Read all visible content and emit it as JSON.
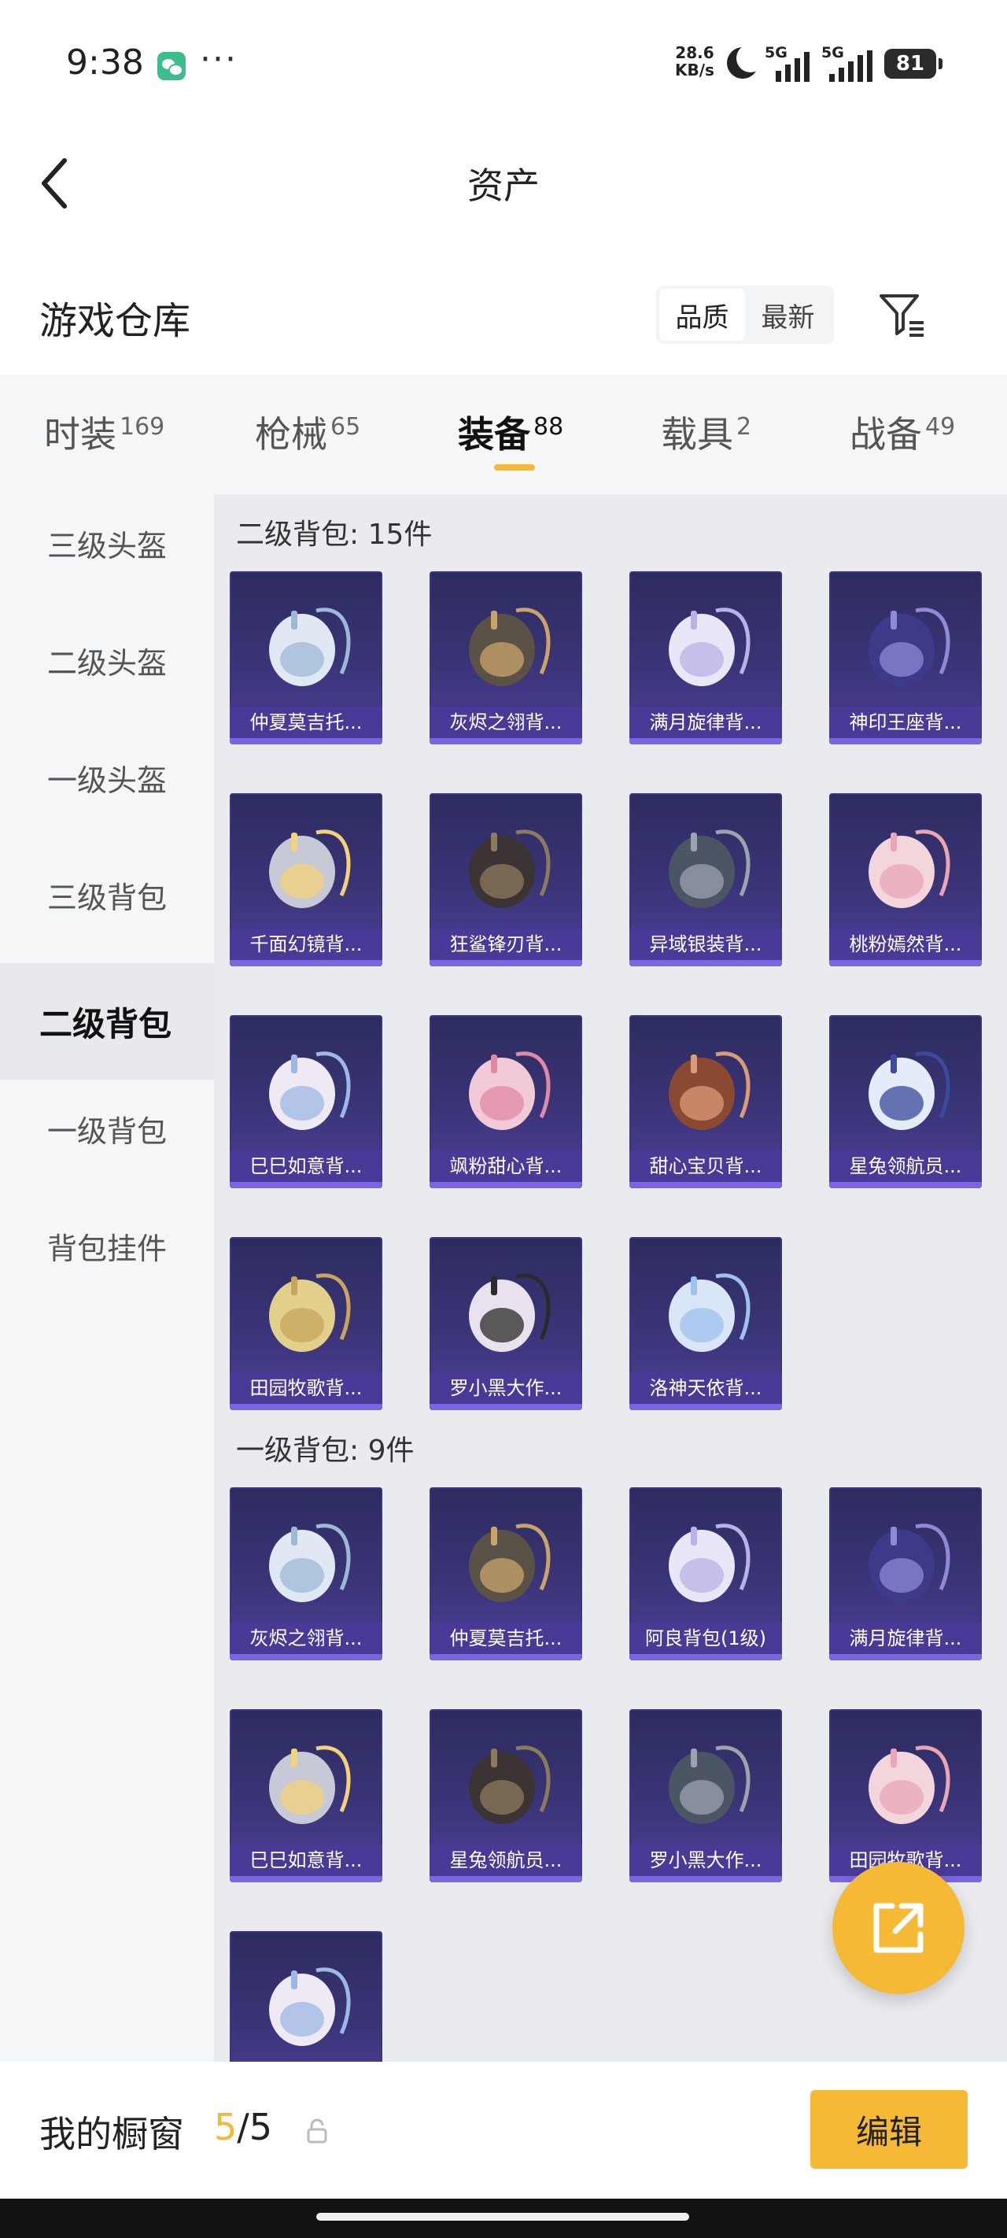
{
  "status": {
    "time": "9:38",
    "net_speed_value": "28.6",
    "net_speed_unit": "KB/s",
    "sim1_label": "5G",
    "sim2_label": "5G",
    "battery": "81",
    "app_icon": "wechat-icon"
  },
  "header": {
    "title": "资产",
    "back_icon": "chevron-left-icon"
  },
  "warehouse": {
    "title": "游戏仓库",
    "sort_options": [
      {
        "label": "品质",
        "active": true
      },
      {
        "label": "最新",
        "active": false
      }
    ],
    "filter_icon": "filter-icon"
  },
  "category_tabs": [
    {
      "label": "时装",
      "count": "169",
      "active": false
    },
    {
      "label": "枪械",
      "count": "65",
      "active": false
    },
    {
      "label": "装备",
      "count": "88",
      "active": true
    },
    {
      "label": "载具",
      "count": "2",
      "active": false
    },
    {
      "label": "战备",
      "count": "49",
      "active": false
    }
  ],
  "sidebar": {
    "items": [
      {
        "label": "三级头盔",
        "active": false
      },
      {
        "label": "二级头盔",
        "active": false
      },
      {
        "label": "一级头盔",
        "active": false
      },
      {
        "label": "三级背包",
        "active": false
      },
      {
        "label": "二级背包",
        "active": true
      },
      {
        "label": "一级背包",
        "active": false
      },
      {
        "label": "背包挂件",
        "active": false
      }
    ]
  },
  "sections": [
    {
      "title": "二级背包: 15件",
      "items": [
        "仲夏莫吉托...",
        "灰烬之翎背...",
        "满月旋律背...",
        "神印王座背...",
        "千面幻镜背...",
        "狂鲨锋刃背...",
        "异域银装背...",
        "桃粉嫣然背...",
        "巳巳如意背...",
        "飒粉甜心背...",
        "甜心宝贝背...",
        "星兔领航员...",
        "田园牧歌背...",
        "罗小黑大作...",
        "洛神天依背..."
      ]
    },
    {
      "title": "一级背包: 9件",
      "items": [
        "灰烬之翎背...",
        "仲夏莫吉托...",
        "阿良背包(1级)",
        "满月旋律背...",
        "巳巳如意背...",
        "星兔领航员...",
        "罗小黑大作...",
        "田园牧歌背...",
        ""
      ]
    }
  ],
  "fab": {
    "icon": "share-external-icon"
  },
  "bottom": {
    "showcase_label": "我的橱窗",
    "showcase_current": "5",
    "showcase_total": "/5",
    "lock_icon": "lock-icon",
    "edit_label": "编辑"
  },
  "colors": {
    "accent": "#f5b935",
    "item_bg_top": "#2c2b5e",
    "item_bg_bottom": "#4f3f9a",
    "item_label_bg": "#4a3a98",
    "content_bg": "#e9ebef",
    "sidebar_bg": "#f5f6f8"
  }
}
